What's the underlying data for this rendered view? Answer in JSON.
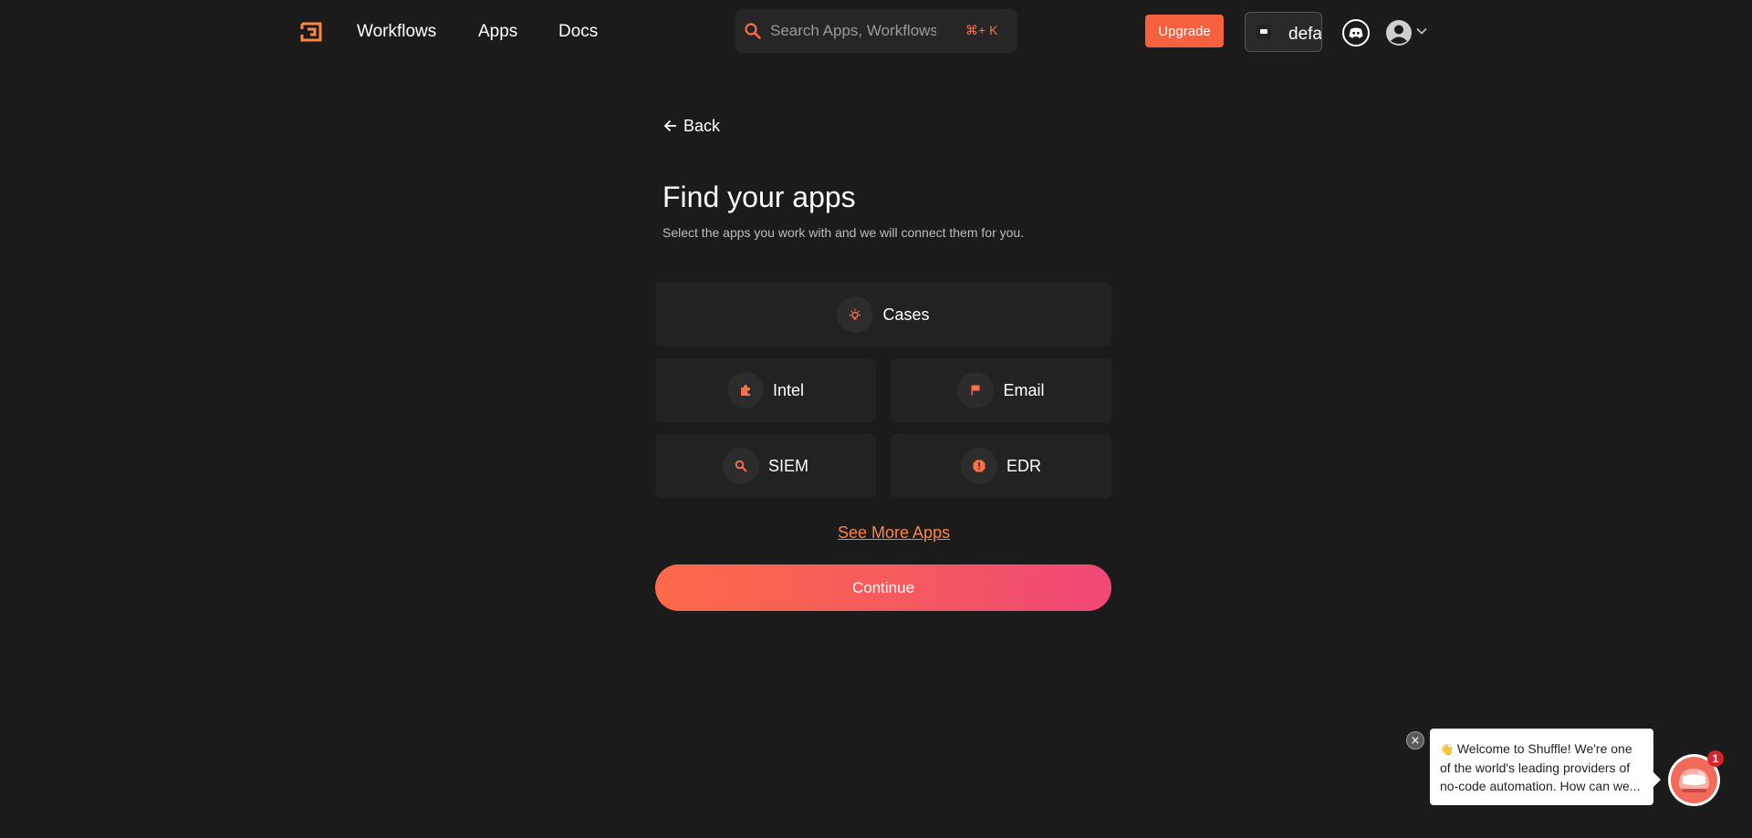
{
  "nav": {
    "links": [
      "Workflows",
      "Apps",
      "Docs"
    ],
    "search_placeholder": "Search Apps, Workflows, Docs",
    "search_shortcut": "⌘+ K",
    "upgrade_label": "Upgrade",
    "org_name": "default",
    "icons": {
      "logo": "shuffle-logo-icon",
      "search": "search-icon",
      "discord": "discord-icon",
      "avatar": "user-avatar-icon",
      "chevron": "chevron-down-icon"
    }
  },
  "main": {
    "back_label": "Back",
    "title": "Find your apps",
    "subtitle": "Select the apps you work with and we will connect them for you.",
    "categories": [
      {
        "label": "Cases",
        "icon": "lightbulb-icon"
      },
      {
        "label": "Intel",
        "icon": "puzzle-icon"
      },
      {
        "label": "Email",
        "icon": "flag-icon"
      },
      {
        "label": "SIEM",
        "icon": "search-icon"
      },
      {
        "label": "EDR",
        "icon": "shield-alert-icon"
      }
    ],
    "see_more_label": "See More Apps",
    "continue_label": "Continue"
  },
  "chat": {
    "emoji": "👋",
    "message": " Welcome to Shuffle! We're one of the world's leading providers of no-code automation. How can we...",
    "badge_count": "1",
    "close_glyph": "×"
  },
  "colors": {
    "background": "#1b1b1b",
    "accent": "#f5613f",
    "link": "#ff8544",
    "card": "#222222",
    "continue_gradient": [
      "#fe6a4a",
      "#f14778"
    ]
  }
}
